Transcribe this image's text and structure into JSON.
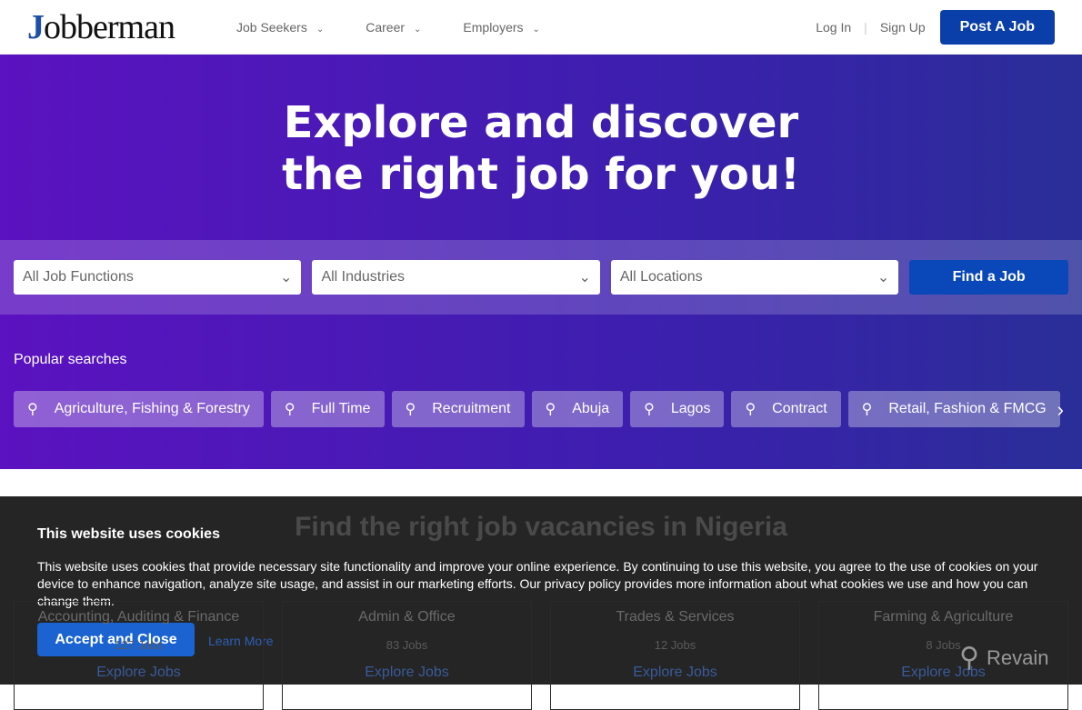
{
  "nav": {
    "logo": "Jobberman",
    "menu": [
      "Job Seekers",
      "Career",
      "Employers"
    ],
    "login": "Log In",
    "signup": "Sign Up",
    "post_job": "Post A Job"
  },
  "hero": {
    "title_line1": "Explore and discover",
    "title_line2": "the right job for you!",
    "filters": [
      "All Job Functions",
      "All Industries",
      "All Locations"
    ],
    "find": "Find a Job",
    "popular_label": "Popular searches",
    "chips": [
      "Agriculture, Fishing & Forestry",
      "Full Time",
      "Recruitment",
      "Abuja",
      "Lagos",
      "Contract",
      "Retail, Fashion & FMCG"
    ]
  },
  "main": {
    "title": "Find the right job vacancies in Nigeria",
    "cards": [
      {
        "name": "Accounting, Auditing & Finance",
        "count": "127 Jobs",
        "link": "Explore Jobs"
      },
      {
        "name": "Admin & Office",
        "count": "83 Jobs",
        "link": "Explore Jobs"
      },
      {
        "name": "Trades & Services",
        "count": "12 Jobs",
        "link": "Explore Jobs"
      },
      {
        "name": "Farming & Agriculture",
        "count": "8 Jobs",
        "link": "Explore Jobs"
      }
    ]
  },
  "cookie": {
    "title": "This website uses cookies",
    "body": "This website uses cookies that provide necessary site functionality and improve your online experience. By continuing to use this website, you agree to the use of cookies on your device to enhance navigation, analyze site usage, and assist in our marketing efforts. Our privacy policy provides more information about what cookies we use and how you can change them.",
    "accept": "Accept and Close",
    "learn": "Learn More"
  },
  "watermark": "Revain"
}
